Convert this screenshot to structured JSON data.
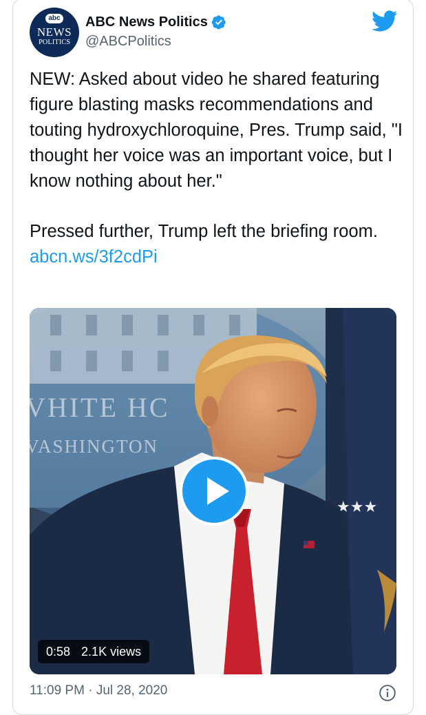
{
  "account": {
    "display_name": "ABC News Politics",
    "handle": "@ABCPolitics",
    "avatar_logo": "abc",
    "avatar_line1": "NEWS",
    "avatar_line2": "POLITICS",
    "verified": true
  },
  "tweet": {
    "paragraph1": "NEW: Asked about video he shared featuring figure blasting masks recommendations and touting hydroxychloroquine, Pres. Trump said, \"I thought her voice was an important voice, but I know nothing about her.\"",
    "paragraph2": "Pressed further, Trump left the briefing room.",
    "link_text": "abcn.ws/3f2cdPi"
  },
  "video": {
    "backdrop_line1": "VHITE HC",
    "backdrop_line2": "VASHINGTON",
    "duration": "0:58",
    "views": "2.1K views"
  },
  "footer": {
    "time": "11:09 PM",
    "separator": "·",
    "date": "Jul 28, 2020"
  },
  "colors": {
    "accent": "#1d9bf0",
    "text": "#0f1419",
    "muted": "#536471",
    "avatar_bg": "#0d2a58",
    "tie": "#c8202c",
    "suit": "#1b2a45"
  },
  "icons": {
    "verified": "verified-badge-icon",
    "brand": "twitter-bird-icon",
    "info": "info-icon",
    "play": "play-icon"
  }
}
